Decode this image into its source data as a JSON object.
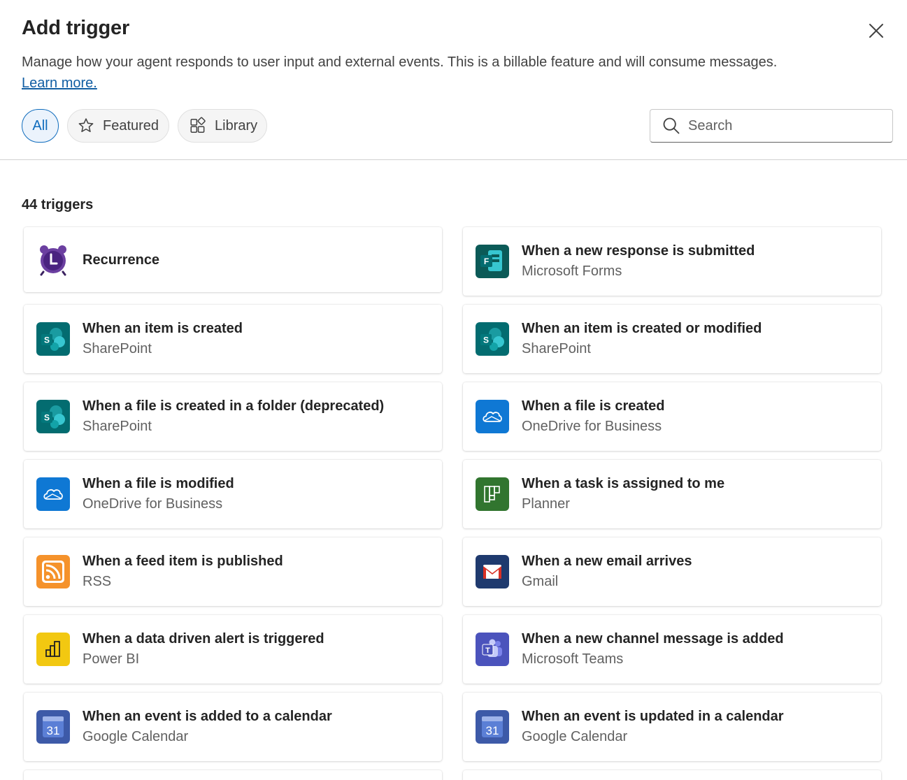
{
  "panel": {
    "title": "Add trigger",
    "description": "Manage how your agent responds to user input and external events. This is a billable feature and will consume messages.",
    "learn_more": "Learn more."
  },
  "filters": {
    "all": "All",
    "featured": "Featured",
    "library": "Library"
  },
  "search": {
    "placeholder": "Search"
  },
  "results": {
    "count_label": "44 triggers"
  },
  "triggers": [
    {
      "title": "Recurrence",
      "source": "",
      "icon": "alarm-clock-icon"
    },
    {
      "title": "When a new response is submitted",
      "source": "Microsoft Forms",
      "icon": "microsoft-forms-icon"
    },
    {
      "title": "When an item is created",
      "source": "SharePoint",
      "icon": "sharepoint-icon"
    },
    {
      "title": "When an item is created or modified",
      "source": "SharePoint",
      "icon": "sharepoint-icon"
    },
    {
      "title": "When a file is created in a folder (deprecated)",
      "source": "SharePoint",
      "icon": "sharepoint-icon"
    },
    {
      "title": "When a file is created",
      "source": "OneDrive for Business",
      "icon": "onedrive-icon"
    },
    {
      "title": "When a file is modified",
      "source": "OneDrive for Business",
      "icon": "onedrive-icon"
    },
    {
      "title": "When a task is assigned to me",
      "source": "Planner",
      "icon": "planner-icon"
    },
    {
      "title": "When a feed item is published",
      "source": "RSS",
      "icon": "rss-icon"
    },
    {
      "title": "When a new email arrives",
      "source": "Gmail",
      "icon": "gmail-icon"
    },
    {
      "title": "When a data driven alert is triggered",
      "source": "Power BI",
      "icon": "power-bi-icon"
    },
    {
      "title": "When a new channel message is added",
      "source": "Microsoft Teams",
      "icon": "teams-icon"
    },
    {
      "title": "When an event is added to a calendar",
      "source": "Google Calendar",
      "icon": "google-calendar-icon"
    },
    {
      "title": "When an event is updated in a calendar",
      "source": "Google Calendar",
      "icon": "google-calendar-icon"
    }
  ],
  "icon_labels": {
    "calendar_day": "31",
    "forms_letter": "F",
    "sharepoint_letter": "S",
    "teams_letter": "T"
  },
  "colors": {
    "accent": "#0f6cbd",
    "link": "#115ea3",
    "sharepoint": "#036c70",
    "onedrive": "#0f78d4",
    "planner": "#31752f",
    "rss": "#f5922b",
    "gmail_bg": "#1f3a6e",
    "power_bi": "#f2c811",
    "teams": "#4b53bc",
    "google_calendar": "#3d5aa8"
  }
}
